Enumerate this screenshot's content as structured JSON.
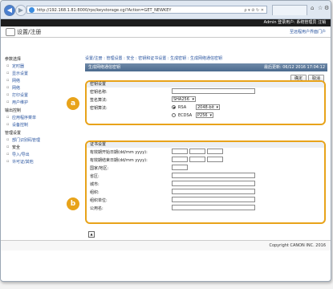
{
  "browser": {
    "url": "http://192.168.1.81:8000/rps/keystorage.cgi?Action=GET_NEWKEY",
    "tools": "ρ ▾ ⊘ ↻ ✕"
  },
  "topbar": {
    "text": "Admin  登录用户: 系统管理员  注销"
  },
  "header": {
    "title": "设置/注册",
    "link": "至远程用户界面门户"
  },
  "sidebar": {
    "sections": [
      {
        "title": "参数选择",
        "items": [
          "定时器",
          "显示设置",
          "网络",
          "网络",
          "打印设置",
          "用户维护"
        ]
      },
      {
        "title": "输出控制",
        "items": [
          "应用程序菜单",
          "设备控制"
        ]
      },
      {
        "title": "管理设置",
        "items": [
          "部门识别码管理",
          "安全",
          "导入/导出",
          "许可证/其他"
        ]
      }
    ]
  },
  "main": {
    "breadcrumb": "设置/注册 : 管理设置 : 安全 : 密钥和证书设置 : 生成密钥 : 生成网络通信密钥",
    "page_title": "生成网络通信密钥",
    "last_updated": "最后更新: 06/12 2016 17:04:12",
    "ok_label": "确定",
    "cancel_label": "取消",
    "key_settings": {
      "legend": "密钥设置",
      "key_name_label": "密钥名称:",
      "sig_label": "签名算法:",
      "sig_value": "SHA256",
      "key_alg_label": "密钥算法:",
      "rsa_label": "RSA",
      "rsa_value": "2048-bit",
      "ecdsa_label": "ECDSA",
      "ecdsa_value": "P256"
    },
    "cert_settings": {
      "legend": "证书设置",
      "fields": [
        "有效期开始日期(dd/mm yyyy):",
        "有效期结束日期(dd/mm yyyy):",
        "国家/地区:",
        "省区:",
        "城市:",
        "组织:",
        "组织单位:",
        "公用名:"
      ]
    },
    "callout_a": "a",
    "callout_b": "b",
    "top_icon": "▲"
  },
  "footer": {
    "copyright": "Copyright CANON INC. 2016"
  }
}
